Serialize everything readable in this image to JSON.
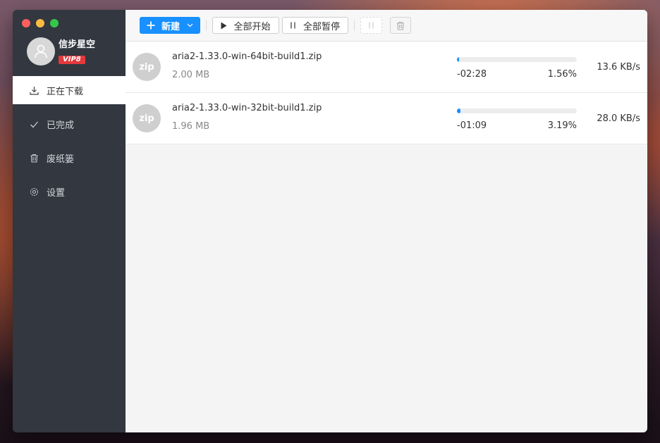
{
  "user": {
    "name": "信步星空",
    "vip_badge": "VIP8"
  },
  "sidebar": {
    "items": [
      {
        "label": "正在下载",
        "icon": "download-icon",
        "active": true
      },
      {
        "label": "已完成",
        "icon": "check-icon",
        "active": false
      },
      {
        "label": "废纸篓",
        "icon": "trash-icon",
        "active": false
      },
      {
        "label": "设置",
        "icon": "gear-icon",
        "active": false
      }
    ]
  },
  "toolbar": {
    "new_label": "新建",
    "start_all_label": "全部开始",
    "pause_all_label": "全部暂停"
  },
  "tasks": [
    {
      "icon_text": "zip",
      "name": "aria2-1.33.0-win-64bit-build1.zip",
      "size": "2.00 MB",
      "eta": "-02:28",
      "percent": "1.56%",
      "progress": 0.0156,
      "speed": "13.6 KB/s"
    },
    {
      "icon_text": "zip",
      "name": "aria2-1.33.0-win-32bit-build1.zip",
      "size": "1.96 MB",
      "eta": "-01:09",
      "percent": "3.19%",
      "progress": 0.0319,
      "speed": "28.0 KB/s"
    }
  ],
  "colors": {
    "accent": "#1890ff",
    "sidebar_bg": "#323740",
    "vip_badge": "#e4393c"
  }
}
